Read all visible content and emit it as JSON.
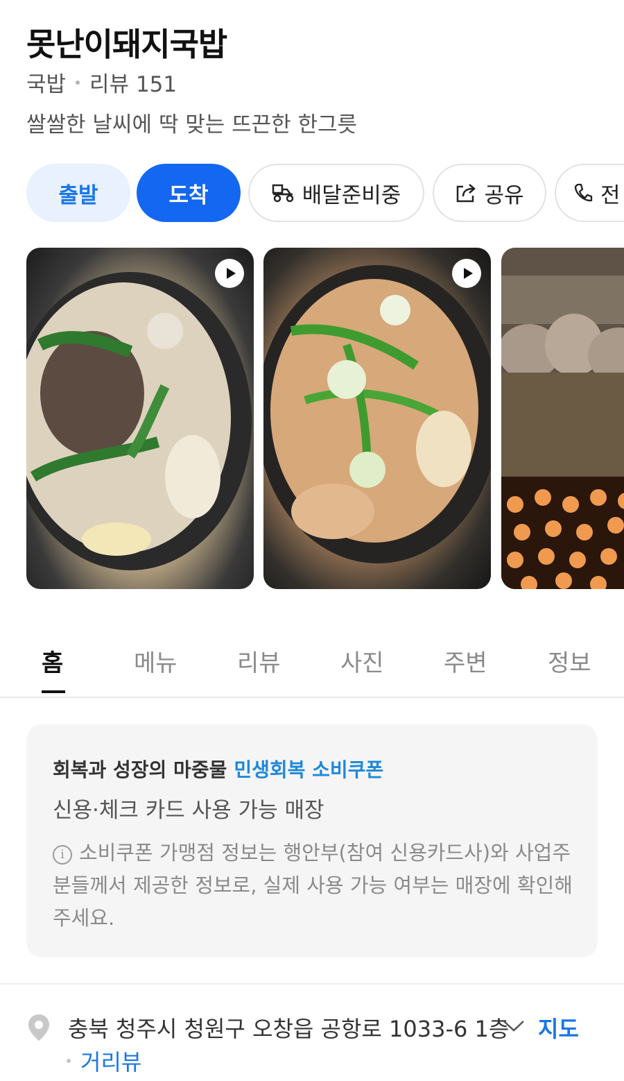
{
  "place": {
    "name": "못난이돼지국밥",
    "category": "국밥",
    "review_label": "리뷰 151",
    "description": "쌀쌀한 날씨에 딱 맞는 뜨끈한 한그릇"
  },
  "actions": {
    "depart": "출발",
    "arrive": "도착",
    "delivery": "배달준비중",
    "share": "공유",
    "call": "전"
  },
  "photos": [
    {
      "icon": "play-icon"
    },
    {
      "icon": "play-icon"
    },
    {
      "icon": ""
    }
  ],
  "tabs": [
    "홈",
    "메뉴",
    "리뷰",
    "사진",
    "주변",
    "정보"
  ],
  "active_tab": "홈",
  "coupon_card": {
    "headline": "회복과 성장의 마중물",
    "headline_accent": "민생회복 소비쿠폰",
    "subtitle": "신용·체크 카드 사용 가능 매장",
    "notice": "소비쿠폰 가맹점 정보는 행안부(참여 신용카드사)와 사업주분들께서 제공한 정보로, 실제 사용 가능 여부는 매장에 확인해 주세요."
  },
  "address": {
    "text": "충북 청주시 청원구 오창읍 공항로 1033-6 1층",
    "map_link": "지도",
    "street_view_link": "거리뷰"
  },
  "colors": {
    "accent_blue": "#1467f0",
    "light_blue_bg": "#e8f1fd",
    "link_blue": "#1976e6",
    "coupon_accent": "#1e88d8"
  }
}
